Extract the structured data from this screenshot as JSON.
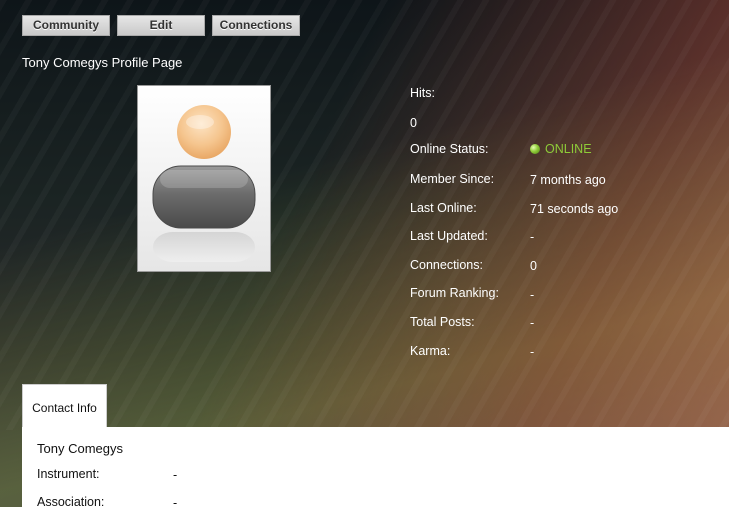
{
  "toolbar": {
    "buttons": [
      "Community",
      "Edit",
      "Connections"
    ]
  },
  "page_title": "Tony Comegys Profile Page",
  "stats": {
    "hits_label": "Hits:",
    "hits_value": "0",
    "online_status_label": "Online Status:",
    "online_status_value": "ONLINE",
    "member_since_label": "Member Since:",
    "member_since_value": "7 months ago",
    "last_online_label": "Last Online:",
    "last_online_value": "71 seconds ago",
    "last_updated_label": "Last Updated:",
    "last_updated_value": "-",
    "connections_label": "Connections:",
    "connections_value": "0",
    "forum_ranking_label": "Forum Ranking:",
    "forum_ranking_value": "-",
    "total_posts_label": "Total Posts:",
    "total_posts_value": "-",
    "karma_label": "Karma:",
    "karma_value": "-"
  },
  "tabs": {
    "contact_info": "Contact Info"
  },
  "contact": {
    "name": "Tony Comegys",
    "instrument_label": "Instrument:",
    "instrument_value": "-",
    "association_label": "Association:",
    "association_value": "-"
  },
  "icons": {
    "avatar": "default-user-avatar-icon",
    "status": "online-status-dot-icon"
  },
  "colors": {
    "online": "#8ecb38"
  }
}
